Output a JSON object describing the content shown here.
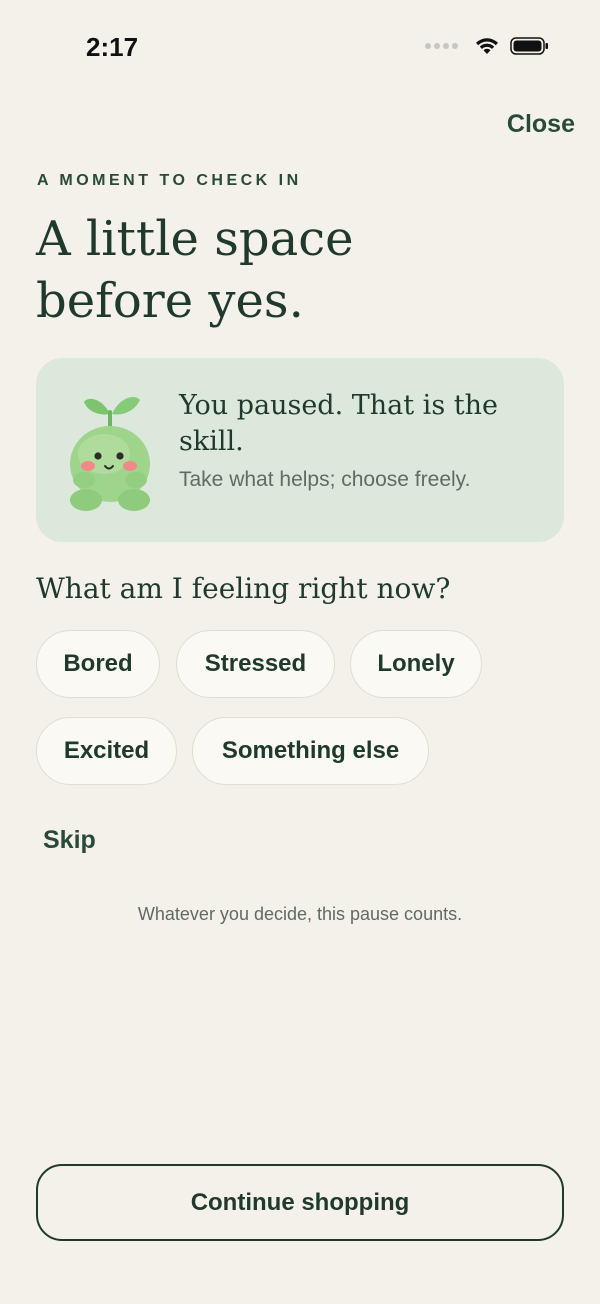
{
  "status_bar": {
    "time": "2:17"
  },
  "header": {
    "close_label": "Close"
  },
  "eyebrow": "A MOMENT TO CHECK IN",
  "headline": "A little space before yes.",
  "card": {
    "mascot_icon": "sprout-mascot-icon",
    "title": "You paused. That is the skill.",
    "subtitle": "Take what helps; choose freely."
  },
  "question": "What am I feeling right now?",
  "feelings": [
    "Bored",
    "Stressed",
    "Lonely",
    "Excited",
    "Something else"
  ],
  "skip_label": "Skip",
  "reassurance": "Whatever you decide, this pause counts.",
  "continue_label": "Continue shopping",
  "colors": {
    "background": "#f4f1ea",
    "accent": "#1f3a2c",
    "card": "#dde8dc",
    "chip": "#fbf9f4"
  }
}
